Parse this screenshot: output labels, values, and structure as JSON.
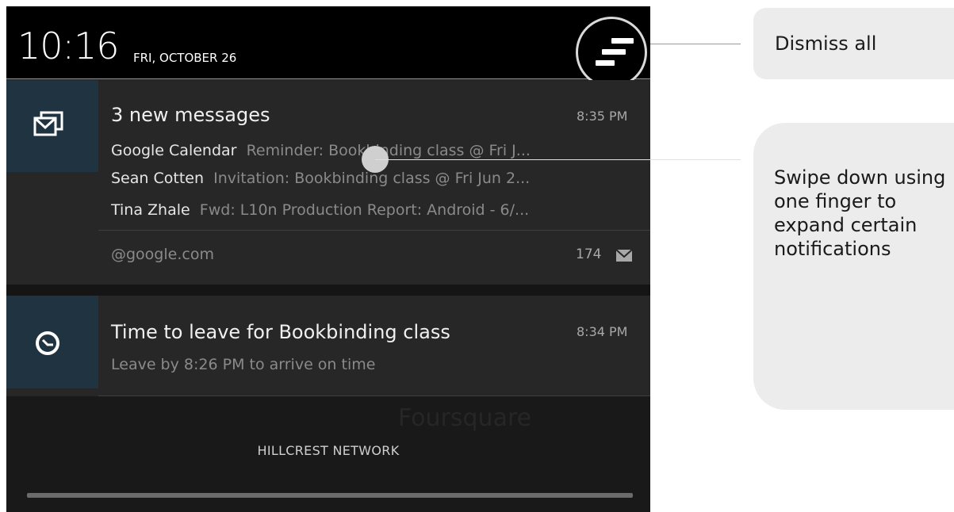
{
  "status_bar": {
    "time": "10:16",
    "date": "FRI, OCTOBER 26",
    "dismiss_icon": "dismiss-all-icon"
  },
  "notifications": [
    {
      "app_icon": "gmail-icon",
      "title": "3 new messages",
      "time": "8:35 PM",
      "lines": [
        {
          "sender": "Google Calendar",
          "text": "Reminder: Bookbinding class @ Fri J..."
        },
        {
          "sender": "Sean Cotten",
          "text": "Invitation: Bookbinding class @ Fri Jun 2..."
        },
        {
          "sender": "Tina Zhale",
          "text": "Fwd: L10n Production Report: Android - 6/..."
        }
      ],
      "account": "@google.com",
      "count": "174",
      "count_icon": "mail-icon"
    },
    {
      "app_icon": "clock-icon",
      "title": "Time to leave for Bookbinding class",
      "time": "8:34 PM",
      "subtitle": "Leave by 8:26 PM to arrive on time"
    }
  ],
  "background_text": "Foursquare",
  "network": "HILLCREST NETWORK",
  "callouts": {
    "dismiss": "Dismiss all",
    "swipe": "Swipe down using one finger to expand certain notifications"
  },
  "colors": {
    "panel_bg": "#1c1c1c",
    "icon_tile": "#1f3440",
    "callout_bg": "#ececec"
  }
}
